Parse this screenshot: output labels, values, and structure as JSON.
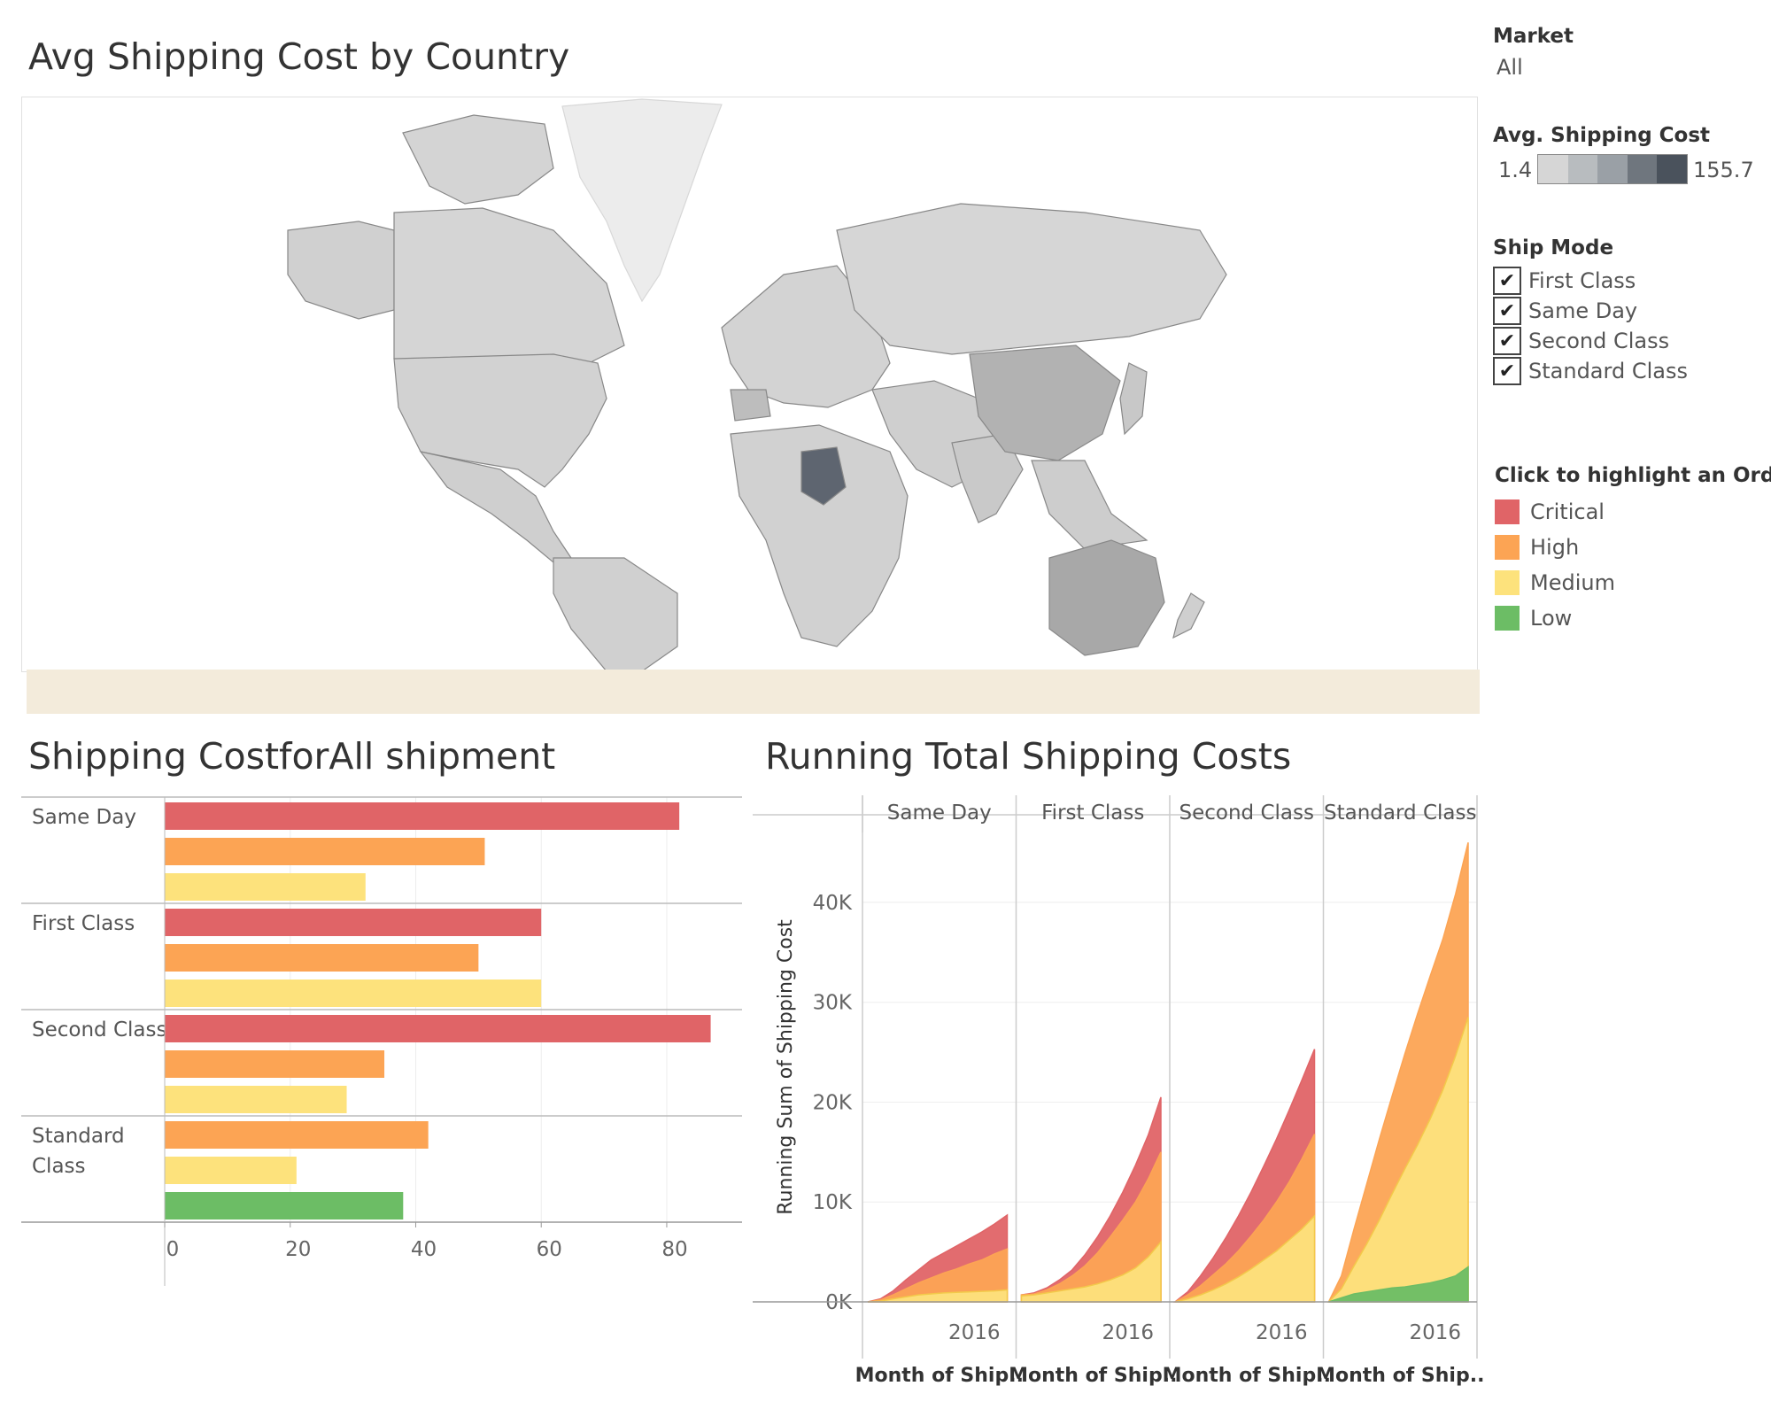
{
  "map": {
    "title": "Avg Shipping Cost by Country"
  },
  "filters": {
    "market_label": "Market",
    "market_value": "All",
    "legend_title": "Avg. Shipping Cost",
    "legend_min": "1.4",
    "legend_max": "155.7",
    "legend_colors": [
      "#d6d6d6",
      "#b8bcbf",
      "#9aa0a6",
      "#6f767e",
      "#4a525c"
    ],
    "ship_mode_label": "Ship Mode",
    "ship_modes": [
      "First Class",
      "Same Day",
      "Second Class",
      "Standard Class"
    ],
    "check_mark": "✔",
    "priority_label": "Click to highlight an Orde..",
    "priorities": [
      {
        "label": "Critical",
        "color": "#e06467"
      },
      {
        "label": "High",
        "color": "#fca454"
      },
      {
        "label": "Medium",
        "color": "#fde27c"
      },
      {
        "label": "Low",
        "color": "#6cbd65"
      }
    ]
  },
  "bar_chart": {
    "title": "Shipping CostforAll shipment"
  },
  "area_chart": {
    "title": "Running Total Shipping Costs"
  },
  "chart_data": [
    {
      "type": "bar",
      "title": "Shipping CostforAll shipment",
      "groups": [
        {
          "label": "Same Day",
          "bars": [
            {
              "priority": "Critical",
              "value": 82
            },
            {
              "priority": "High",
              "value": 51
            },
            {
              "priority": "Medium",
              "value": 32
            }
          ]
        },
        {
          "label": "First Class",
          "bars": [
            {
              "priority": "Critical",
              "value": 60
            },
            {
              "priority": "High",
              "value": 50
            },
            {
              "priority": "Medium",
              "value": 60
            }
          ]
        },
        {
          "label": "Second Class",
          "bars": [
            {
              "priority": "Critical",
              "value": 87
            },
            {
              "priority": "High",
              "value": 35
            },
            {
              "priority": "Medium",
              "value": 29
            }
          ]
        },
        {
          "label": "Standard Class",
          "bars": [
            {
              "priority": "High",
              "value": 42
            },
            {
              "priority": "Medium",
              "value": 21
            },
            {
              "priority": "Low",
              "value": 38
            }
          ]
        }
      ],
      "x_ticks": [
        "0",
        "20",
        "40",
        "60",
        "80"
      ],
      "xlim": [
        0,
        92
      ],
      "grid": true
    },
    {
      "type": "area",
      "title": "Running Total Shipping Costs",
      "ylabel": "Running Sum of Shipping Cost",
      "xlabel": "Month of Ship..",
      "x_tick": "2016",
      "y_ticks": [
        "0K",
        "10K",
        "20K",
        "30K",
        "40K"
      ],
      "ylim": [
        0,
        47000
      ],
      "panels": [
        {
          "label": "Same Day",
          "stack": [
            {
              "priority": "Medium",
              "values": [
                0,
                80,
                300,
                500,
                700,
                800,
                900,
                950,
                1000,
                1050,
                1100,
                1200
              ]
            },
            {
              "priority": "High",
              "values": [
                0,
                200,
                700,
                1300,
                1900,
                2400,
                2900,
                3300,
                3800,
                4200,
                4800,
                5300
              ]
            },
            {
              "priority": "Critical",
              "values": [
                0,
                300,
                1100,
                2200,
                3200,
                4200,
                4900,
                5600,
                6300,
                7000,
                7800,
                8700
              ]
            }
          ]
        },
        {
          "label": "First Class",
          "stack": [
            {
              "priority": "Medium",
              "values": [
                600,
                700,
                900,
                1100,
                1300,
                1500,
                1800,
                2200,
                2700,
                3400,
                4500,
                6000
              ]
            },
            {
              "priority": "High",
              "values": [
                700,
                800,
                1200,
                1800,
                2600,
                3600,
                4900,
                6500,
                8200,
                10000,
                12300,
                15000
              ]
            },
            {
              "priority": "Critical",
              "values": [
                700,
                900,
                1400,
                2200,
                3200,
                4700,
                6500,
                8600,
                11000,
                13700,
                16700,
                20500
              ]
            }
          ]
        },
        {
          "label": "Second Class",
          "stack": [
            {
              "priority": "Medium",
              "values": [
                0,
                300,
                700,
                1200,
                1800,
                2500,
                3300,
                4200,
                5100,
                6200,
                7300,
                8600
              ]
            },
            {
              "priority": "High",
              "values": [
                0,
                700,
                1600,
                2700,
                3800,
                5100,
                6600,
                8200,
                10000,
                12000,
                14300,
                16800
              ]
            },
            {
              "priority": "Critical",
              "values": [
                0,
                1000,
                2600,
                4400,
                6400,
                8600,
                11000,
                13600,
                16300,
                19200,
                22200,
                25300
              ]
            }
          ]
        },
        {
          "label": "Standard Class",
          "stack": [
            {
              "priority": "Low",
              "values": [
                0,
                400,
                800,
                1000,
                1200,
                1400,
                1500,
                1700,
                1900,
                2200,
                2600,
                3500
              ]
            },
            {
              "priority": "Medium",
              "values": [
                0,
                1300,
                3600,
                5800,
                8200,
                10800,
                13300,
                15700,
                18300,
                21200,
                24600,
                28500
              ]
            },
            {
              "priority": "High",
              "values": [
                0,
                2600,
                7300,
                11800,
                16300,
                20600,
                24800,
                28800,
                32600,
                36300,
                40800,
                46000
              ]
            }
          ]
        }
      ]
    }
  ]
}
